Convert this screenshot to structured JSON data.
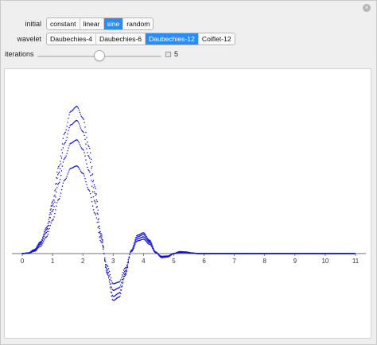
{
  "controls": {
    "initial": {
      "label": "initial",
      "options": [
        "constant",
        "linear",
        "sine",
        "random"
      ],
      "selected": "sine"
    },
    "wavelet": {
      "label": "wavelet",
      "options": [
        "Daubechies-4",
        "Daubechies-6",
        "Daubechies-12",
        "Coiflet-12"
      ],
      "selected": "Daubechies-12"
    },
    "iterations": {
      "label": "iterations",
      "value": "5"
    },
    "accent_color": "#2a8cf7"
  },
  "chart_data": {
    "type": "scatter",
    "series_color": "#1010d8",
    "xlim": [
      0,
      11
    ],
    "ylim": [
      -1.6,
      4.8
    ],
    "x_ticks": [
      "0",
      "1",
      "2",
      "3",
      "4",
      "5",
      "6",
      "7",
      "8",
      "9",
      "10",
      "11"
    ],
    "y_ticks": [],
    "title": "",
    "xlabel": "",
    "ylabel": "",
    "series": [
      {
        "x": [
          0,
          0.2,
          0.4,
          0.6,
          0.8,
          1.0,
          1.2,
          1.4,
          1.6,
          1.8,
          2.0,
          2.2,
          2.4,
          2.6,
          2.8,
          3.0,
          3.2,
          3.4,
          3.6,
          3.8,
          4.0,
          4.2,
          4.4,
          4.6,
          4.8,
          5.0,
          5.2,
          5.4,
          5.6,
          5.8,
          6.0,
          6.2,
          6.4,
          7,
          8,
          9,
          10,
          11
        ],
        "y": [
          0,
          0.02,
          0.12,
          0.35,
          0.78,
          1.55,
          2.6,
          3.6,
          4.25,
          4.4,
          4.05,
          3.2,
          2.0,
          0.6,
          -0.6,
          -1.4,
          -1.3,
          -0.65,
          0.1,
          0.55,
          0.62,
          0.4,
          0.05,
          -0.12,
          -0.1,
          0.0,
          0.06,
          0.05,
          0.02,
          0.0,
          0.0,
          0.0,
          0.0,
          0,
          0,
          0,
          0,
          0
        ]
      },
      {
        "x": [
          0,
          0.2,
          0.4,
          0.6,
          0.8,
          1.0,
          1.2,
          1.4,
          1.6,
          1.8,
          2.0,
          2.2,
          2.4,
          2.6,
          2.8,
          3.0,
          3.2,
          3.4,
          3.6,
          3.8,
          4.0,
          4.2,
          4.4,
          4.6,
          4.8,
          5.0,
          5.2,
          5.4,
          5.6,
          5.8,
          6.0,
          6.2,
          6.4,
          7,
          8,
          9,
          10,
          11
        ],
        "y": [
          0,
          0.02,
          0.1,
          0.32,
          0.72,
          1.45,
          2.4,
          3.3,
          3.85,
          3.98,
          3.65,
          2.9,
          1.8,
          0.55,
          -0.55,
          -1.28,
          -1.18,
          -0.6,
          0.08,
          0.5,
          0.57,
          0.37,
          0.04,
          -0.11,
          -0.09,
          0.0,
          0.05,
          0.04,
          0.02,
          0.0,
          0.0,
          0.0,
          0.0,
          0,
          0,
          0,
          0,
          0
        ]
      },
      {
        "x": [
          0,
          0.2,
          0.4,
          0.6,
          0.8,
          1.0,
          1.2,
          1.4,
          1.6,
          1.8,
          2.0,
          2.2,
          2.4,
          2.6,
          2.8,
          3.0,
          3.2,
          3.4,
          3.6,
          3.8,
          4.0,
          4.2,
          4.4,
          4.6,
          4.8,
          5.0,
          5.2,
          5.4,
          5.6,
          5.8,
          6.0,
          6.2,
          6.4,
          7,
          8,
          9,
          10,
          11
        ],
        "y": [
          0,
          0.02,
          0.09,
          0.28,
          0.63,
          1.28,
          2.1,
          2.85,
          3.3,
          3.4,
          3.12,
          2.48,
          1.55,
          0.47,
          -0.47,
          -1.1,
          -1.02,
          -0.52,
          0.07,
          0.44,
          0.5,
          0.33,
          0.04,
          -0.1,
          -0.08,
          0.0,
          0.04,
          0.04,
          0.02,
          0.0,
          0.0,
          0.0,
          0.0,
          0,
          0,
          0,
          0,
          0
        ]
      },
      {
        "x": [
          0,
          0.2,
          0.4,
          0.6,
          0.8,
          1.0,
          1.2,
          1.4,
          1.6,
          1.8,
          2.0,
          2.2,
          2.4,
          2.6,
          2.8,
          3.0,
          3.2,
          3.4,
          3.6,
          3.8,
          4.0,
          4.2,
          4.4,
          4.6,
          4.8,
          5.0,
          5.2,
          5.4,
          5.6,
          5.8,
          6.0,
          6.2,
          6.4,
          7,
          8,
          9,
          10,
          11
        ],
        "y": [
          0,
          0.01,
          0.07,
          0.22,
          0.5,
          1.0,
          1.62,
          2.2,
          2.55,
          2.62,
          2.4,
          1.9,
          1.2,
          0.36,
          -0.36,
          -0.9,
          -0.85,
          -0.43,
          0.06,
          0.38,
          0.43,
          0.28,
          0.03,
          -0.08,
          -0.07,
          0.0,
          0.03,
          0.03,
          0.01,
          0.0,
          0.0,
          0.0,
          0.0,
          0,
          0,
          0,
          0,
          0
        ]
      }
    ]
  }
}
